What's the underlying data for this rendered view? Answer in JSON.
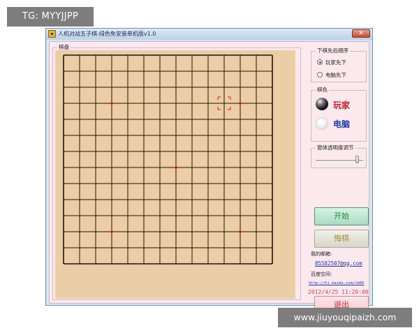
{
  "watermarks": {
    "top_left": "TG: MYYJJPP",
    "bottom_right": "www.jiuyouqipaizh.com"
  },
  "window": {
    "title": "人机对战五子棋-绿色免安装单机版v1.0",
    "close_glyph": "✕"
  },
  "board_panel": {
    "label": "棋盘",
    "grid_cells": 13,
    "board_color": "#ebcda6",
    "line_color": "#1e1408",
    "star_point_color": "#e01010",
    "cursor_color": "#e01010",
    "star_points": [
      [
        3,
        3
      ],
      [
        11,
        3
      ],
      [
        7,
        7
      ],
      [
        3,
        11
      ],
      [
        11,
        11
      ]
    ],
    "cursor_intersection": [
      10,
      3
    ]
  },
  "order_panel": {
    "label": "下棋先后顺序",
    "options": [
      {
        "label": "玩家先下",
        "checked": true
      },
      {
        "label": "电脑先下",
        "checked": false
      }
    ]
  },
  "color_panel": {
    "label": "棋色",
    "player": {
      "label": "玩家",
      "stone": "black",
      "label_color": "#c8202a"
    },
    "computer": {
      "label": "电脑",
      "stone": "white",
      "label_color": "#1f3aa8"
    }
  },
  "transparency_panel": {
    "label": "窗体透明度调节",
    "level_percent": 100
  },
  "buttons": {
    "start": "开始",
    "undo": "悔棋",
    "exit": "退出"
  },
  "contact": {
    "email_label": "我的邮箱:",
    "email": "85582507@qq.com",
    "space_label": "百度空间:",
    "space_url": "http://hi.baidu.com/cb05"
  },
  "timestamp": "2012/4/25 11:20:00"
}
